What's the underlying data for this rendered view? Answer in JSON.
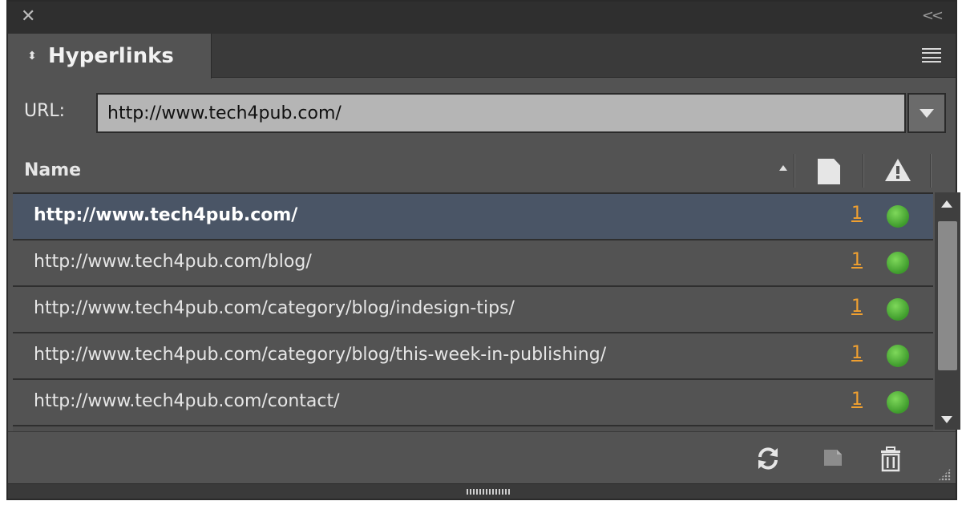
{
  "panel": {
    "close_symbol": "✕",
    "collapse_symbol": "<<",
    "tab_label": "Hyperlinks",
    "tab_arrows": "⬍"
  },
  "url": {
    "label": "URL:",
    "value": "http://www.tech4pub.com/"
  },
  "columns": {
    "name": "Name"
  },
  "hyperlinks": [
    {
      "name": "http://www.tech4pub.com/",
      "count": "1",
      "status": "ok",
      "selected": true
    },
    {
      "name": "http://www.tech4pub.com/blog/",
      "count": "1",
      "status": "ok",
      "selected": false
    },
    {
      "name": "http://www.tech4pub.com/category/blog/indesign-tips/",
      "count": "1",
      "status": "ok",
      "selected": false
    },
    {
      "name": "http://www.tech4pub.com/category/blog/this-week-in-publishing/",
      "count": "1",
      "status": "ok",
      "selected": false
    },
    {
      "name": "http://www.tech4pub.com/contact/",
      "count": "1",
      "status": "ok",
      "selected": false
    }
  ],
  "icons": {
    "menu": "panel-menu-icon",
    "page": "page-icon",
    "warning": "warning-icon",
    "refresh": "refresh-icon",
    "new_hyperlink": "new-hyperlink-icon",
    "delete": "trash-icon"
  },
  "colors": {
    "panel_bg": "#535353",
    "selected_row": "#4a5566",
    "count_link": "#f0a030",
    "status_ok": "#4caf35"
  }
}
